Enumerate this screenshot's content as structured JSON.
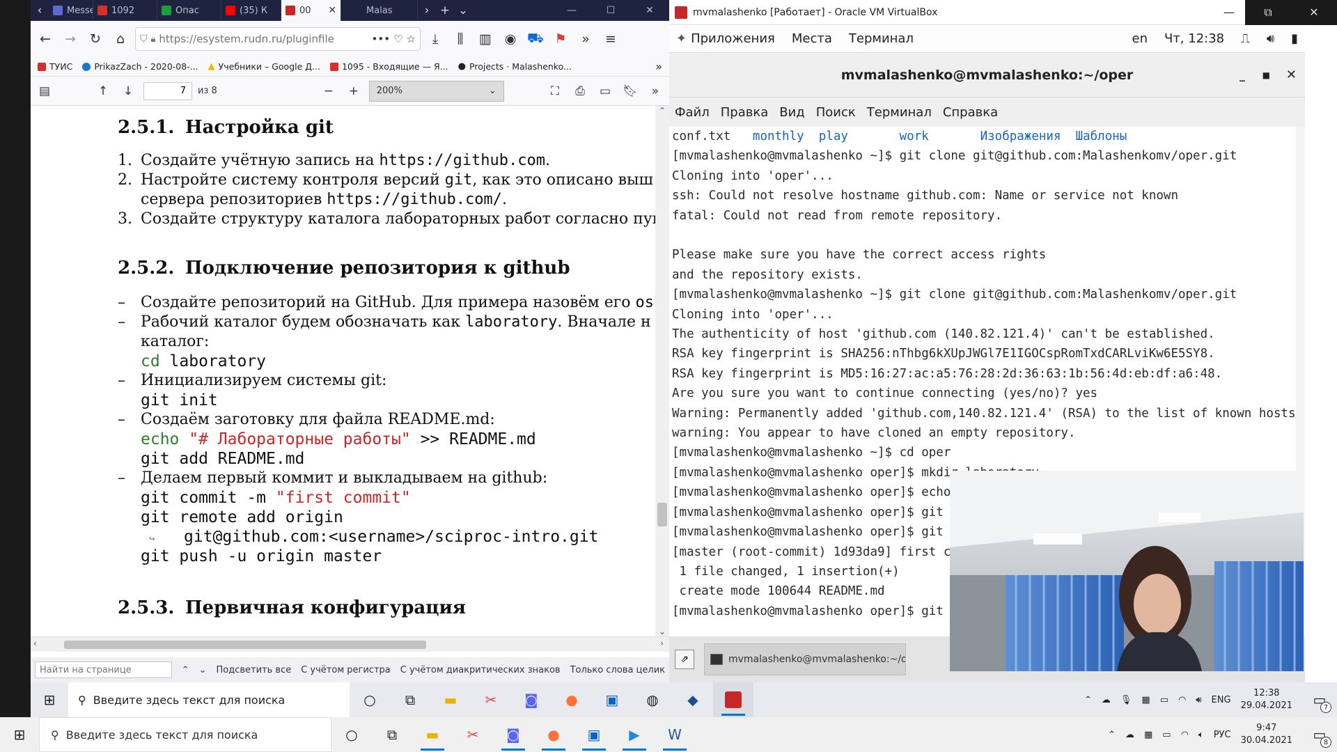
{
  "firefox": {
    "tabs": [
      {
        "label": "Messe",
        "favicon_color": "#5e6ad2"
      },
      {
        "label": "1092",
        "favicon_color": "#d93025"
      },
      {
        "label": "Опас",
        "favicon_color": "#1b9e3e"
      },
      {
        "label": "(35) К",
        "favicon_color": "#ff0000"
      },
      {
        "label": "00",
        "favicon_color": "#c62828"
      },
      {
        "label": "Malas",
        "favicon_color": "#555555"
      }
    ],
    "url": "https://esystem.rudn.ru/pluginfile",
    "bookmarks": [
      {
        "label": "ТУИС",
        "color": "#d32f2f"
      },
      {
        "label": "PrikazZach - 2020-08-...",
        "color": "#1976d2"
      },
      {
        "label": "Учебники – Google Д...",
        "color": "#f4b400"
      },
      {
        "label": "1095 - Входящие — Я...",
        "color": "#d93025"
      },
      {
        "label": "Projects · Malashenko...",
        "color": "#222222"
      }
    ],
    "pdf": {
      "page_current": "7",
      "page_total": "из 8",
      "zoom": "200%"
    },
    "find": {
      "placeholder": "Найти на странице",
      "highlight_all": "Подсветить все",
      "match_case": "С учётом регистра",
      "diacritics": "С учётом диакритических знаков",
      "whole_words": "Только слова целик"
    }
  },
  "document": {
    "s251": {
      "num": "2.5.1.",
      "title": "Настройка git"
    },
    "s251_items": [
      {
        "n": "1.",
        "pre": "Создайте учётную запись на ",
        "code": "https://github.com",
        "post": "."
      },
      {
        "n": "2.",
        "pre": "Настройте систему контроля версий ",
        "code": "git",
        "post": ", как это описано выш"
      },
      {
        "n": "",
        "pre": "сервера репозиториев ",
        "code": "https://github.com/",
        "post": "."
      },
      {
        "n": "3.",
        "pre": "Создайте структуру каталога лабораторных работ согласно пунк",
        "code": "",
        "post": ""
      }
    ],
    "s252": {
      "num": "2.5.2.",
      "title": "Подключение репозитория к github"
    },
    "s252_lines": {
      "l1_pre": "Создайте репозиторий на GitHub. Для примера назовём его ",
      "l1_code": "os-",
      "l2_pre": "Рабочий каталог будем обозначать как ",
      "l2_code": "laboratory",
      "l2_post": ". Вначале н",
      "l3": "каталог:",
      "c1_kw": "cd",
      "c1_rest": " laboratory",
      "l4": "Инициализируем системы git:",
      "c2": "git init",
      "l5_pre": "Создаём заготовку для файла ",
      "l5_code": "README.md",
      "l5_post": ":",
      "c3_kw": "echo",
      "c3_str": " \"# Лабораторные работы\"",
      "c3_rest": " >> README.md",
      "c4": "git add README.md",
      "l6": "Делаем первый коммит и выкладываем на github:",
      "c5_pre": "git commit -m ",
      "c5_str": "\"first commit\"",
      "c6": "git remote add origin",
      "c7": "git@github.com:<username>/sciproc-intro.git",
      "c8": "git push -u origin master"
    },
    "s253": {
      "num": "2.5.3.",
      "title": "Первичная конфигурация"
    }
  },
  "vbox": {
    "title": "mvmalashenko [Работает] - Oracle VM VirtualBox",
    "gnome": {
      "apps": "Приложения",
      "places": "Места",
      "terminal": "Терминал",
      "lang": "en",
      "clock": "Чт, 12:38"
    },
    "terminal": {
      "title": "mvmalashenko@mvmalashenko:~/oper",
      "menu": [
        "Файл",
        "Правка",
        "Вид",
        "Поиск",
        "Терминал",
        "Справка"
      ],
      "ls_line": {
        "file": "conf.txt",
        "dirs": [
          "monthly",
          "play",
          "work",
          "Изображения",
          "Шаблоны"
        ]
      },
      "lines": [
        "[mvmalashenko@mvmalashenko ~]$ git clone git@github.com:Malashenkomv/oper.git",
        "Cloning into 'oper'...",
        "ssh: Could not resolve hostname github.com: Name or service not known",
        "fatal: Could not read from remote repository.",
        "",
        "Please make sure you have the correct access rights",
        "and the repository exists.",
        "[mvmalashenko@mvmalashenko ~]$ git clone git@github.com:Malashenkomv/oper.git",
        "Cloning into 'oper'...",
        "The authenticity of host 'github.com (140.82.121.4)' can't be established.",
        "RSA key fingerprint is SHA256:nThbg6kXUpJWGl7E1IGOCspRomTxdCARLviKw6E5SY8.",
        "RSA key fingerprint is MD5:16:27:ac:a5:76:28:2d:36:63:1b:56:4d:eb:df:a6:48.",
        "Are you sure you want to continue connecting (yes/no)? yes",
        "Warning: Permanently added 'github.com,140.82.121.4' (RSA) to the list of known hosts.",
        "warning: You appear to have cloned an empty repository.",
        "[mvmalashenko@mvmalashenko ~]$ cd oper",
        "[mvmalashenko@mvmalashenko oper]$ mkdir laboratory",
        "[mvmalashenko@mvmalashenko oper]$ echo",
        "[mvmalashenko@mvmalashenko oper]$ git a",
        "[mvmalashenko@mvmalashenko oper]$ git c",
        "[master (root-commit) 1d93da9] first co",
        " 1 file changed, 1 insertion(+)",
        " create mode 100644 README.md",
        "[mvmalashenko@mvmalashenko oper]$ git p"
      ]
    },
    "task_item": "mvmalashenko@mvmalashenko:~/o..."
  },
  "vm_taskbar": {
    "search_placeholder": "Введите здесь текст для поиска",
    "lang": "ENG",
    "time": "12:38",
    "date": "29.04.2021",
    "notif": "7"
  },
  "host_taskbar": {
    "search_placeholder": "Введите здесь текст для поиска",
    "lang": "РУС",
    "time": "9:47",
    "date": "30.04.2021",
    "notif": "8"
  }
}
